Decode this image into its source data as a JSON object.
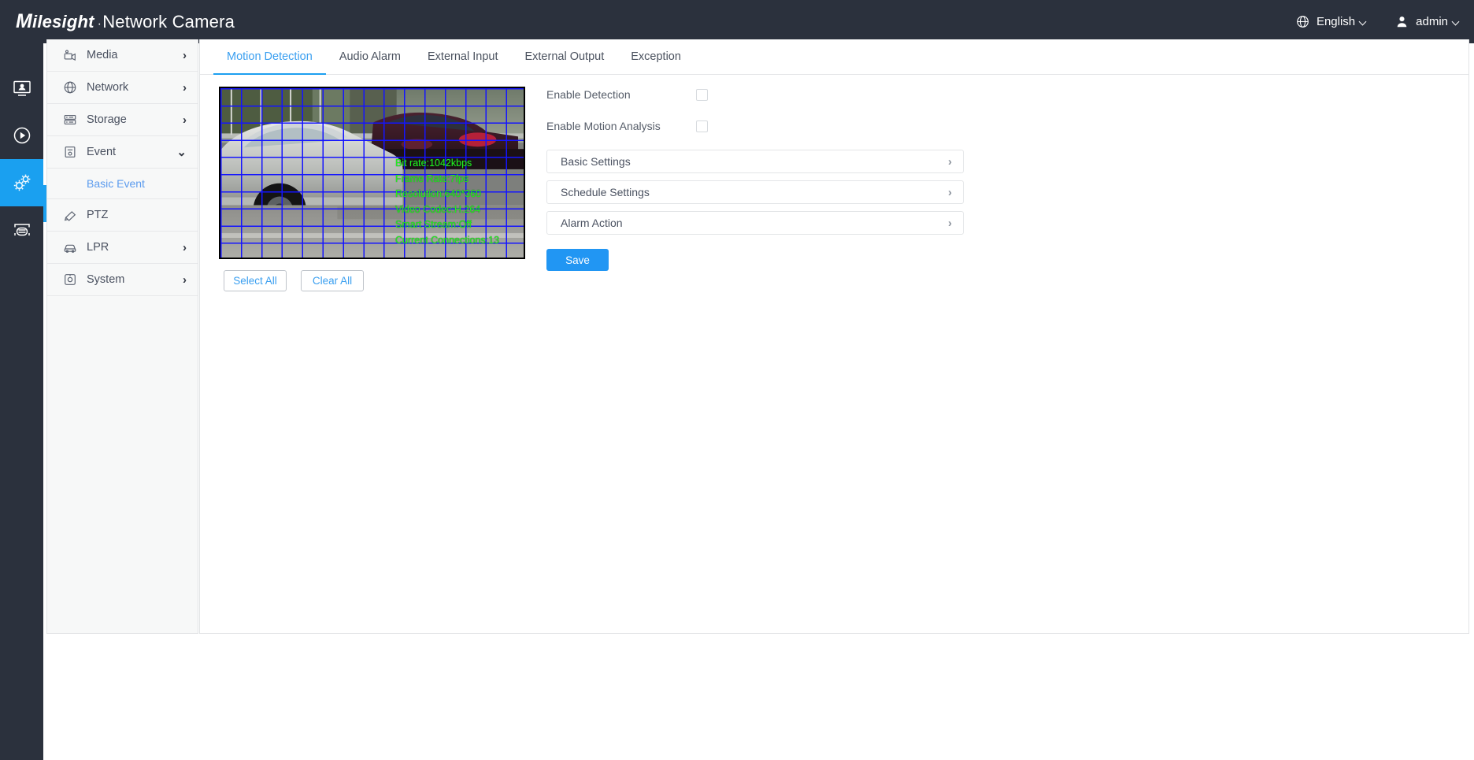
{
  "header": {
    "logo_cap": "M",
    "logo_brand_rest": "ilesight",
    "logo_dot": "·",
    "logo_suffix": "Network Camera",
    "language": "English",
    "user": "admin",
    "globe_icon": "globe-icon",
    "user_icon": "user-icon"
  },
  "rail": {
    "items": [
      {
        "name": "live-view",
        "icon": "monitor-icon",
        "active": false
      },
      {
        "name": "playback",
        "icon": "play-circle-icon",
        "active": false
      },
      {
        "name": "settings",
        "icon": "gears-icon",
        "active": true
      },
      {
        "name": "lpr",
        "icon": "vehicle-icon",
        "active": false
      }
    ]
  },
  "sidebar": {
    "items": [
      {
        "label": "Media",
        "icon": "camcorder-icon",
        "chevron": "›"
      },
      {
        "label": "Network",
        "icon": "globe-icon",
        "chevron": "›"
      },
      {
        "label": "Storage",
        "icon": "storage-icon",
        "chevron": "›"
      },
      {
        "label": "Event",
        "icon": "event-icon",
        "chevron": "⌄"
      },
      {
        "label": "PTZ",
        "icon": "ptz-icon",
        "chevron": ""
      },
      {
        "label": "LPR",
        "icon": "car-icon",
        "chevron": "›"
      },
      {
        "label": "System",
        "icon": "system-icon",
        "chevron": "›"
      }
    ],
    "submenu": {
      "label": "Basic Event"
    }
  },
  "tabs": [
    {
      "label": "Motion Detection",
      "active": true
    },
    {
      "label": "Audio Alarm",
      "active": false
    },
    {
      "label": "External Input",
      "active": false
    },
    {
      "label": "External Output",
      "active": false
    },
    {
      "label": "Exception",
      "active": false
    }
  ],
  "preview": {
    "osd_lines": [
      "Bit rate:1042kbps",
      "Frame Rate:7fps",
      "Resolution:640*360",
      "Video Codec:H.264",
      "Smart Stream:Off",
      "Current Connections:13"
    ],
    "select_all": "Select All",
    "clear_all": "Clear All"
  },
  "settings": {
    "fields": [
      {
        "label": "Enable Detection",
        "checked": false
      },
      {
        "label": "Enable Motion Analysis",
        "checked": false
      }
    ],
    "accordion": [
      {
        "label": "Basic Settings",
        "chevron": "›"
      },
      {
        "label": "Schedule Settings",
        "chevron": "›"
      },
      {
        "label": "Alarm Action",
        "chevron": "›"
      }
    ],
    "save_label": "Save"
  },
  "colors": {
    "accent": "#1aa0f0",
    "header_bg": "#2b313d",
    "link": "#3a9ff0",
    "grid": "#1414ff",
    "osd": "#22ee22"
  }
}
